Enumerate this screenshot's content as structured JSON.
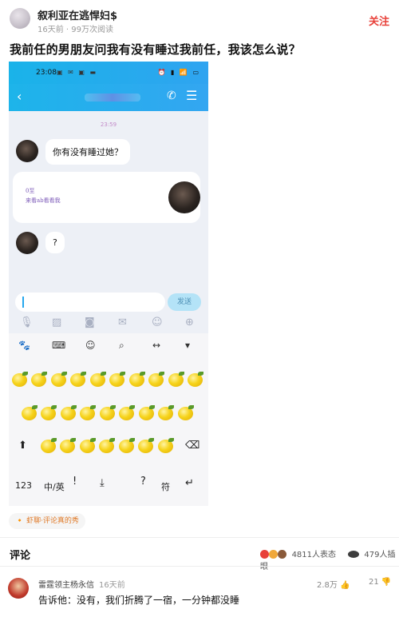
{
  "author": {
    "name": "叙利亚在逃悍妇$",
    "meta": "16天前 · 99万次阅读"
  },
  "follow_label": "关注",
  "question": "我前任的男朋友问我有没有睡过我前任，我该怎么说？",
  "phone": {
    "status_time": "23:08",
    "status_icons": "▣ ✉ ▣ ▬",
    "status_right": "⏰ ▮ 📶 ▭",
    "message_time": "23:59",
    "messages": [
      "你有没有睡过她？",
      "?"
    ],
    "handwriting": [
      "0至",
      "来看ab看看我"
    ],
    "send_label": "发送",
    "keyboard": {
      "top_icons": [
        "du-icon",
        "keyboard-icon",
        "emoji-icon",
        "search-icon",
        "cursor-icon",
        "hide-keyboard-icon"
      ],
      "bottom_keys": [
        "123",
        "中/英",
        "!",
        "?",
        "符"
      ]
    }
  },
  "tag": "🔸 虾聊·评论真的秀",
  "comments": {
    "title": "评论",
    "reaction_count": "4811人表态",
    "view_count": "479人插眼",
    "items": [
      {
        "author": "雷霆领主杨永信",
        "time": "16天前",
        "likes": "2.8万",
        "replies": "21",
        "text": "告诉他：没有，我们折腾了一宿，一分钟都没睡"
      }
    ]
  },
  "colors": {
    "accent": "#e8413a",
    "chat_header": "#1db4ea",
    "lemon": "#f6d31b"
  }
}
